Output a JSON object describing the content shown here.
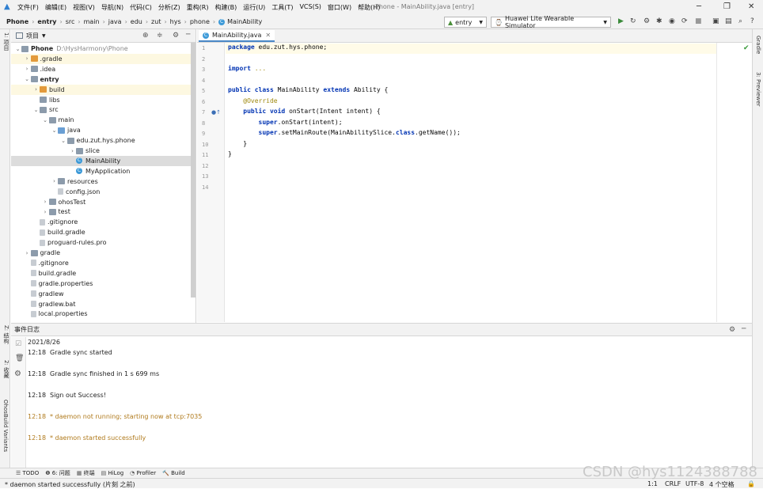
{
  "menus": [
    "文件(F)",
    "编辑(E)",
    "视图(V)",
    "导航(N)",
    "代码(C)",
    "分析(Z)",
    "重构(R)",
    "构建(B)",
    "运行(U)",
    "工具(T)",
    "VCS(S)",
    "窗口(W)",
    "帮助(H)"
  ],
  "window_title": "Phone - MainAbility.java [entry]",
  "breadcrumb": [
    "Phone",
    "entry",
    "src",
    "main",
    "java",
    "edu",
    "zut",
    "hys",
    "phone",
    "MainAbility"
  ],
  "toolbar": {
    "module_combo": "entry",
    "device_combo": "Huawei Lite Wearable Simulator"
  },
  "project_panel": {
    "title": "项目",
    "tree": [
      {
        "label": "Phone",
        "path": "D:\\HysHarmony\\Phone",
        "depth": 0,
        "arrow": "open",
        "icon": "folder-grey",
        "bold": true
      },
      {
        "label": ".gradle",
        "depth": 1,
        "arrow": "closed",
        "icon": "folder-orange",
        "hl": true
      },
      {
        "label": ".idea",
        "depth": 1,
        "arrow": "closed",
        "icon": "folder-grey"
      },
      {
        "label": "entry",
        "depth": 1,
        "arrow": "open",
        "icon": "folder-grey",
        "bold": true
      },
      {
        "label": "build",
        "depth": 2,
        "arrow": "closed",
        "icon": "folder-orange",
        "hl": true
      },
      {
        "label": "libs",
        "depth": 2,
        "arrow": "none",
        "icon": "folder-grey"
      },
      {
        "label": "src",
        "depth": 2,
        "arrow": "open",
        "icon": "folder-grey"
      },
      {
        "label": "main",
        "depth": 3,
        "arrow": "open",
        "icon": "folder-grey"
      },
      {
        "label": "java",
        "depth": 4,
        "arrow": "open",
        "icon": "folder-blue"
      },
      {
        "label": "edu.zut.hys.phone",
        "depth": 5,
        "arrow": "open",
        "icon": "folder-grey"
      },
      {
        "label": "slice",
        "depth": 6,
        "arrow": "closed",
        "icon": "folder-grey"
      },
      {
        "label": "MainAbility",
        "depth": 6,
        "arrow": "none",
        "icon": "class",
        "sel": true
      },
      {
        "label": "MyApplication",
        "depth": 6,
        "arrow": "none",
        "icon": "class"
      },
      {
        "label": "resources",
        "depth": 4,
        "arrow": "closed",
        "icon": "folder-grey"
      },
      {
        "label": "config.json",
        "depth": 4,
        "arrow": "none",
        "icon": "file"
      },
      {
        "label": "ohosTest",
        "depth": 3,
        "arrow": "closed",
        "icon": "folder-grey"
      },
      {
        "label": "test",
        "depth": 3,
        "arrow": "closed",
        "icon": "folder-grey"
      },
      {
        "label": ".gitignore",
        "depth": 2,
        "arrow": "none",
        "icon": "file"
      },
      {
        "label": "build.gradle",
        "depth": 2,
        "arrow": "none",
        "icon": "file"
      },
      {
        "label": "proguard-rules.pro",
        "depth": 2,
        "arrow": "none",
        "icon": "file"
      },
      {
        "label": "gradle",
        "depth": 1,
        "arrow": "closed",
        "icon": "folder-grey"
      },
      {
        "label": ".gitignore",
        "depth": 1,
        "arrow": "none",
        "icon": "file"
      },
      {
        "label": "build.gradle",
        "depth": 1,
        "arrow": "none",
        "icon": "file"
      },
      {
        "label": "gradle.properties",
        "depth": 1,
        "arrow": "none",
        "icon": "file"
      },
      {
        "label": "gradlew",
        "depth": 1,
        "arrow": "none",
        "icon": "file"
      },
      {
        "label": "gradlew.bat",
        "depth": 1,
        "arrow": "none",
        "icon": "file"
      },
      {
        "label": "local.properties",
        "depth": 1,
        "arrow": "none",
        "icon": "file"
      }
    ]
  },
  "editor": {
    "tab": "MainAbility.java",
    "lines": [
      [
        {
          "t": "package ",
          "c": "kw"
        },
        {
          "t": "edu.zut.hys.phone;"
        }
      ],
      [],
      [
        {
          "t": "import ",
          "c": "kw"
        },
        {
          "t": "...",
          "c": "ann"
        }
      ],
      [],
      [
        {
          "t": "public ",
          "c": "kw"
        },
        {
          "t": "class ",
          "c": "kw"
        },
        {
          "t": "MainAbility "
        },
        {
          "t": "extends ",
          "c": "kw"
        },
        {
          "t": "Ability {"
        }
      ],
      [
        {
          "t": "    "
        },
        {
          "t": "@Override",
          "c": "ann"
        }
      ],
      [
        {
          "t": "    "
        },
        {
          "t": "public ",
          "c": "kw"
        },
        {
          "t": "void ",
          "c": "kw"
        },
        {
          "t": "onStart(Intent intent) {"
        }
      ],
      [
        {
          "t": "        "
        },
        {
          "t": "super",
          "c": "kw"
        },
        {
          "t": ".onStart(intent);"
        }
      ],
      [
        {
          "t": "        "
        },
        {
          "t": "super",
          "c": "kw"
        },
        {
          "t": ".setMainRoute(MainAbilitySlice."
        },
        {
          "t": "class",
          "c": "kw"
        },
        {
          "t": ".getName());"
        }
      ],
      [
        {
          "t": "    }"
        }
      ],
      [
        {
          "t": "}"
        }
      ],
      [],
      [],
      []
    ]
  },
  "event_log": {
    "title": "事件日志",
    "date": "2021/8/26",
    "entries": [
      {
        "time": "12:18",
        "text": "Gradle sync started",
        "warn": false
      },
      {
        "time": "12:18",
        "text": "Gradle sync finished in 1 s 699 ms",
        "warn": false
      },
      {
        "time": "12:18",
        "text": "Sign out Success!",
        "warn": false
      },
      {
        "time": "12:18",
        "text": "* daemon not running; starting now at tcp:7035",
        "warn": true
      },
      {
        "time": "12:18",
        "text": "* daemon started successfully",
        "warn": true
      }
    ]
  },
  "left_strip": {
    "project": "1: 项目",
    "structure": "Z: 结构",
    "favorites": "2: 收藏",
    "variants": "OhosBuild Variants"
  },
  "right_strip": {
    "gradle": "Gradle",
    "previewer": "3: Previewer"
  },
  "bottom_tabs": [
    "TODO",
    "6: 问题",
    "终端",
    "HiLog",
    "Profiler",
    "Build"
  ],
  "status": {
    "message": "* daemon started successfully (片刻 之前)",
    "position": "1:1",
    "line_sep": "CRLF",
    "encoding": "UTF-8",
    "indent": "4 个空格"
  },
  "watermark": "CSDN @hys1124388788"
}
